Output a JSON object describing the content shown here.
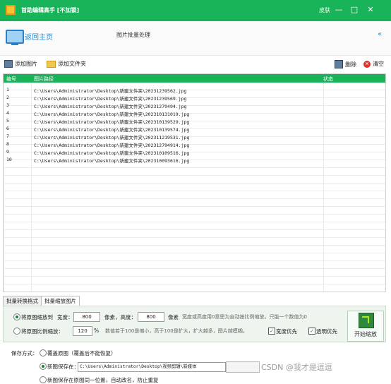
{
  "window": {
    "title": "首助编辑高手 [不加锁]",
    "skin_label": "皮肤",
    "minimize": "—",
    "maximize": "□",
    "close": "✕"
  },
  "header": {
    "back_home": "返回主页",
    "page_title": "图片批量处理",
    "collapse": "«"
  },
  "toolbar": {
    "add_image": "添加图片",
    "add_folder": "添加文件夹",
    "delete": "删除",
    "clear": "清空"
  },
  "table": {
    "columns": [
      "编号",
      "图片路径",
      "状态"
    ],
    "rows": [
      {
        "num": "1",
        "path": "C:\\Users\\Administrator\\Desktop\\新建文件夹\\20231239562.jpg"
      },
      {
        "num": "2",
        "path": "C:\\Users\\Administrator\\Desktop\\新建文件夹\\20231239569.jpg"
      },
      {
        "num": "3",
        "path": "C:\\Users\\Administrator\\Desktop\\新建文件夹\\20231279494.jpg"
      },
      {
        "num": "4",
        "path": "C:\\Users\\Administrator\\Desktop\\新建文件夹\\202310131019.jpg"
      },
      {
        "num": "5",
        "path": "C:\\Users\\Administrator\\Desktop\\新建文件夹\\202310139529.jpg"
      },
      {
        "num": "6",
        "path": "C:\\Users\\Administrator\\Desktop\\新建文件夹\\202310139574.jpg"
      },
      {
        "num": "7",
        "path": "C:\\Users\\Administrator\\Desktop\\新建文件夹\\202311219531.jpg"
      },
      {
        "num": "8",
        "path": "C:\\Users\\Administrator\\Desktop\\新建文件夹\\202312794914.jpg"
      },
      {
        "num": "9",
        "path": "C:\\Users\\Administrator\\Desktop\\新建文件夹\\202310109516.jpg"
      },
      {
        "num": "10",
        "path": "C:\\Users\\Administrator\\Desktop\\新建文件夹\\202310093616.jpg"
      }
    ]
  },
  "tabs": [
    {
      "label": "批量转换格式"
    },
    {
      "label": "批量缩放图片"
    }
  ],
  "resize": {
    "option_scale_to": "将原图缩放到",
    "width_label": "宽度：",
    "width_value": "800",
    "px_height_label": "像素，高度：",
    "height_value": "800",
    "px_label": "像素",
    "hint_wh": "宽度或高度用0意思为自动按比例缩放，只能一个数值为0",
    "option_scale_percent": "将原图比例缩放：",
    "percent_value": "120",
    "percent_unit": "%",
    "hint_percent": "数值若于100是缩小，高于100是扩大，扩大越多，图片越模糊。",
    "width_priority": "宽度优先",
    "transparent_priority": "透明优先",
    "start_label": "开始缩放"
  },
  "save": {
    "label": "保存方式：",
    "overwrite": "覆盖原图（覆盖后不能恢复）",
    "new_location": "新图保存在：",
    "path": "C:\\Users\\Administrator\\Desktop\\视频剪辑\\新媒体",
    "same_location": "新图保存在原图同一位置，自动改名，防止重复",
    "watermark": "CSDN @我才是逗逗"
  }
}
